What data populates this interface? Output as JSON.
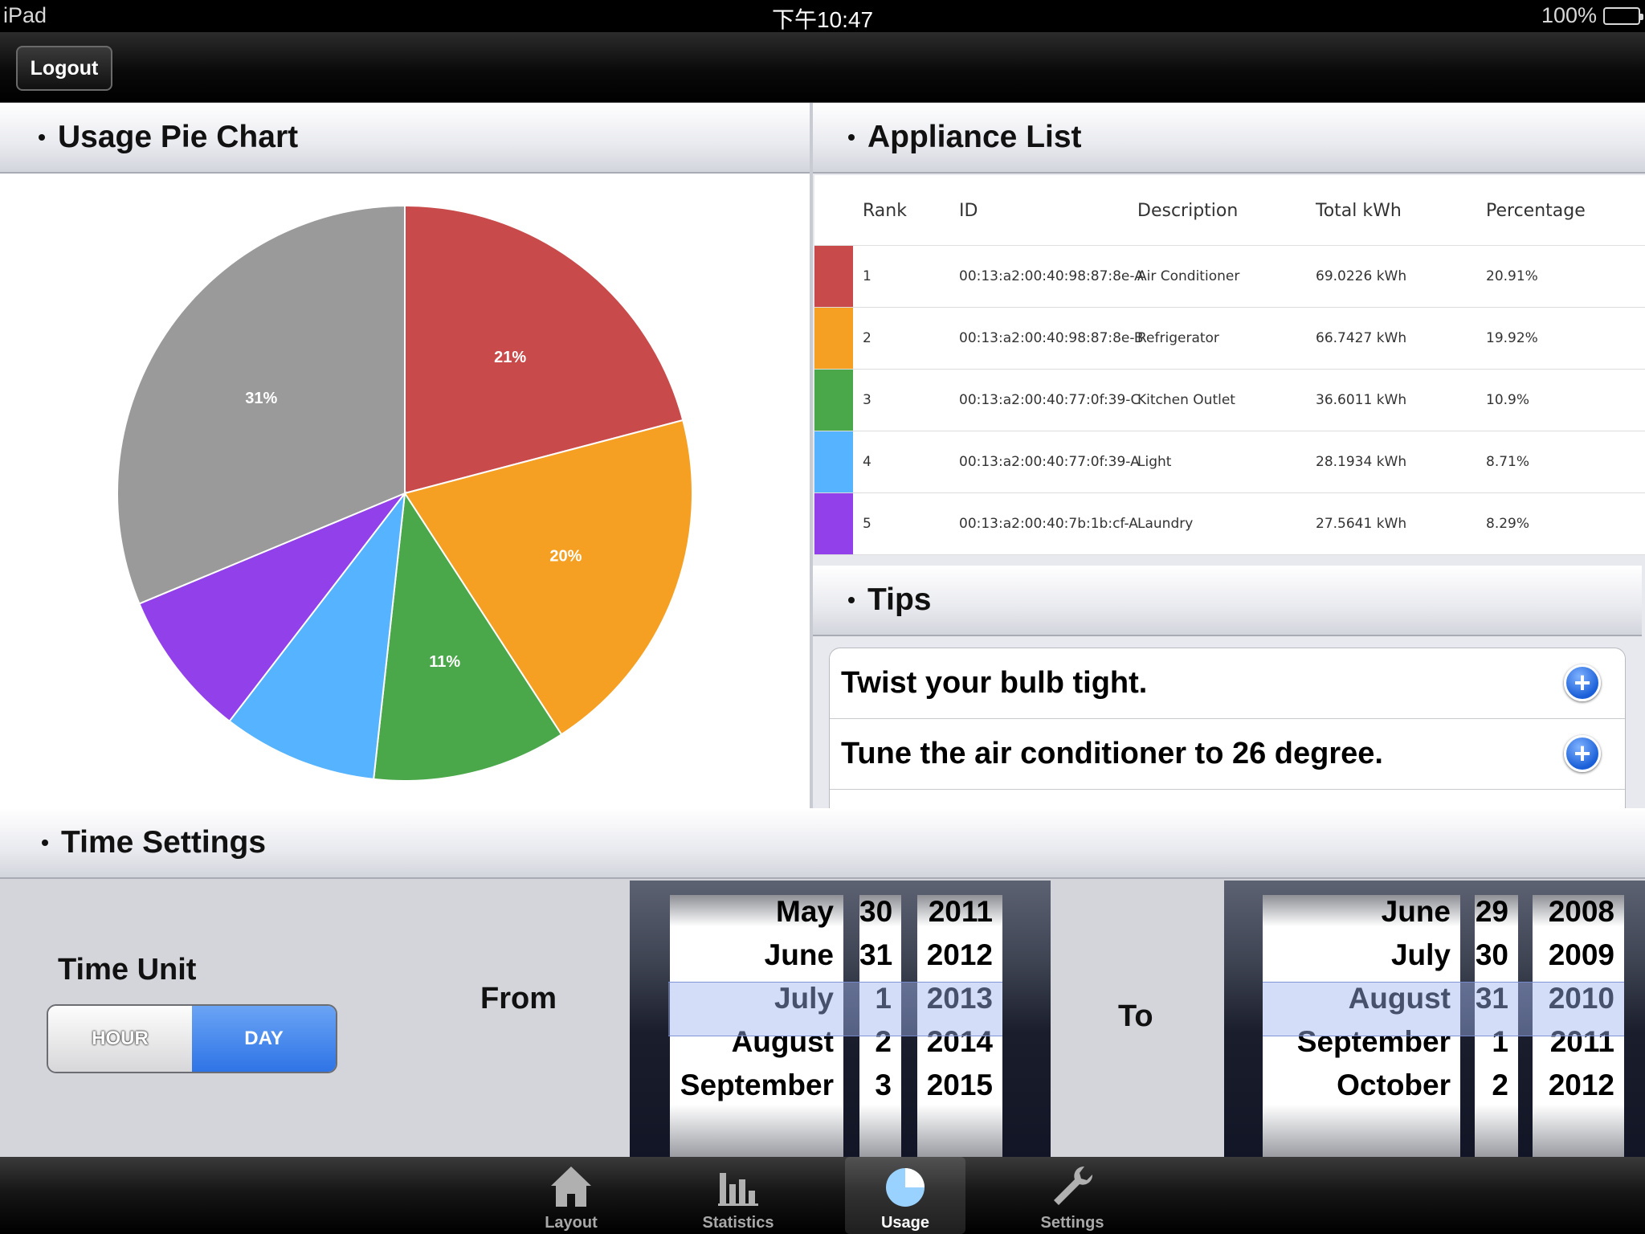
{
  "status_bar": {
    "device": "iPad",
    "time": "下午10:47",
    "battery": "100%"
  },
  "nav": {
    "logout_label": "Logout"
  },
  "usage_panel": {
    "title": "Usage Pie Chart"
  },
  "chart_data": {
    "type": "pie",
    "slices": [
      {
        "label": "Air Conditioner",
        "value": 20.91,
        "display": "21%",
        "color": "#c94a4a"
      },
      {
        "label": "Refrigerator",
        "value": 19.92,
        "display": "20%",
        "color": "#f5a022"
      },
      {
        "label": "Kitchen Outlet",
        "value": 10.9,
        "display": "11%",
        "color": "#4aa74a"
      },
      {
        "label": "Light",
        "value": 8.71,
        "display": "",
        "color": "#55b3ff"
      },
      {
        "label": "Laundry",
        "value": 8.29,
        "display": "",
        "color": "#9240e9"
      },
      {
        "label": "Other",
        "value": 31.27,
        "display": "31%",
        "color": "#9a9a9a"
      }
    ]
  },
  "appliance_panel": {
    "title": "Appliance List",
    "columns": [
      "Rank",
      "ID",
      "Description",
      "Total kWh",
      "Percentage"
    ],
    "rows": [
      {
        "rank": "1",
        "id": "00:13:a2:00:40:98:87:8e-A",
        "desc": "Air Conditioner",
        "kwh": "69.0226 kWh",
        "pct": "20.91%",
        "color": "#c94a4a"
      },
      {
        "rank": "2",
        "id": "00:13:a2:00:40:98:87:8e-B",
        "desc": "Refrigerator",
        "kwh": "66.7427 kWh",
        "pct": "19.92%",
        "color": "#f5a022"
      },
      {
        "rank": "3",
        "id": "00:13:a2:00:40:77:0f:39-C",
        "desc": "Kitchen Outlet",
        "kwh": "36.6011 kWh",
        "pct": "10.9%",
        "color": "#4aa74a"
      },
      {
        "rank": "4",
        "id": "00:13:a2:00:40:77:0f:39-A",
        "desc": "Light",
        "kwh": "28.1934 kWh",
        "pct": "8.71%",
        "color": "#55b3ff"
      },
      {
        "rank": "5",
        "id": "00:13:a2:00:40:7b:1b:cf-A",
        "desc": "Laundry",
        "kwh": "27.5641 kWh",
        "pct": "8.29%",
        "color": "#9240e9"
      }
    ]
  },
  "tips_panel": {
    "title": "Tips",
    "items": [
      {
        "text": "Twist your bulb tight.",
        "action": "plus-icon"
      },
      {
        "text": "Tune the air conditioner to 26  degree.",
        "action": "plus-icon"
      }
    ]
  },
  "time_settings": {
    "title": "Time Settings",
    "time_unit_label": "Time Unit",
    "unit_options": [
      "HOUR",
      "DAY"
    ],
    "selected_unit": "DAY",
    "from_label": "From",
    "to_label": "To",
    "from_picker": {
      "months": [
        "May",
        "June",
        "July",
        "August",
        "September"
      ],
      "days": [
        "30",
        "31",
        "1",
        "2",
        "3"
      ],
      "years": [
        "2011",
        "2012",
        "2013",
        "2014",
        "2015"
      ],
      "selected": {
        "month": "July",
        "day": "1",
        "year": "2013"
      }
    },
    "to_picker": {
      "months": [
        "June",
        "July",
        "August",
        "September",
        "October"
      ],
      "days": [
        "29",
        "30",
        "31",
        "1",
        "2"
      ],
      "years": [
        "2008",
        "2009",
        "2010",
        "2011",
        "2012"
      ],
      "selected": {
        "month": "August",
        "day": "31",
        "year": "2010"
      }
    }
  },
  "tab_bar": {
    "tabs": [
      {
        "label": "Layout",
        "icon": "home-icon"
      },
      {
        "label": "Statistics",
        "icon": "bar-chart-icon"
      },
      {
        "label": "Usage",
        "icon": "pie-chart-icon"
      },
      {
        "label": "Settings",
        "icon": "wrench-icon"
      }
    ],
    "active": "Usage"
  }
}
